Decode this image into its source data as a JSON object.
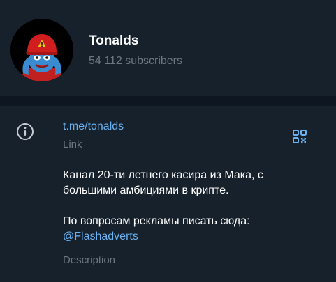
{
  "channel": {
    "name": "Tonalds",
    "subscribers": "54 112 subscribers",
    "avatar_icon": "pepe-red-cap-avatar"
  },
  "info": {
    "icon": "info-icon",
    "link": {
      "value": "t.me/tonalds",
      "label": "Link",
      "qr_icon": "qr-code-icon"
    },
    "description": {
      "line1": "Канал 20-ти летнего касира из Мака, с",
      "line2": "большими амбициями в крипте.",
      "line3": "По вопросам рекламы писать сюда:",
      "mention": "@Flashadverts",
      "label": "Description"
    }
  },
  "colors": {
    "background": "#17212b",
    "divider": "#0e1621",
    "accent": "#6ab2f2",
    "secondary_text": "#6d7883",
    "primary_text": "#ffffff",
    "qr_icon": "#6ab2f2"
  }
}
